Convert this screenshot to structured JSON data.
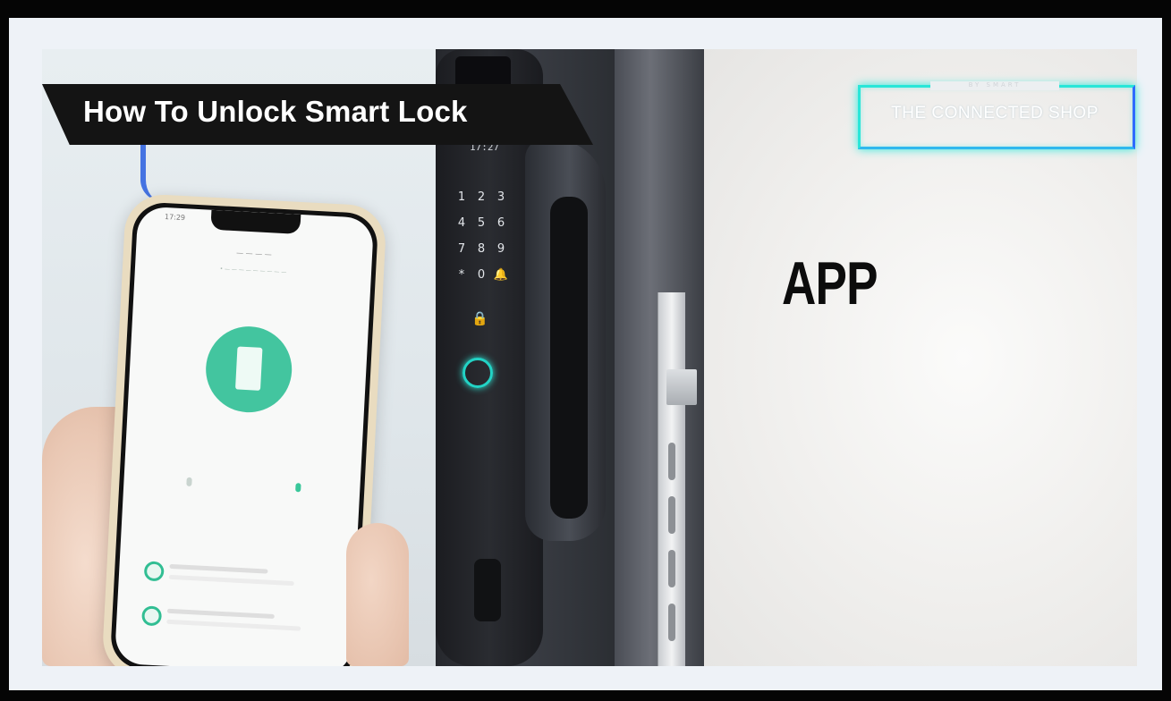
{
  "video": {
    "title_banner": "How To Unlock Smart Lock",
    "method_label": "APP"
  },
  "logo": {
    "tagline": "BY SMART",
    "name": "THE CONNECTED SHOP",
    "icon": "wifi-icon"
  },
  "lock": {
    "time": "17:27",
    "keys": [
      "1",
      "2",
      "3",
      "4",
      "5",
      "6",
      "7",
      "8",
      "9",
      "*",
      "0",
      "🔔"
    ],
    "lock_glyph": "🔒",
    "fingerprint_color": "#22d3c5"
  },
  "phone": {
    "status_time": "17:29",
    "unlock_button_color": "#2fbf95",
    "icons": [
      "door-icon",
      "key-icon",
      "list-icon"
    ]
  },
  "colors": {
    "banner_bg": "#141414",
    "banner_text": "#ffffff",
    "logo_neon": "#29e6d8",
    "logo_neon_accent": "#2f6bff"
  }
}
